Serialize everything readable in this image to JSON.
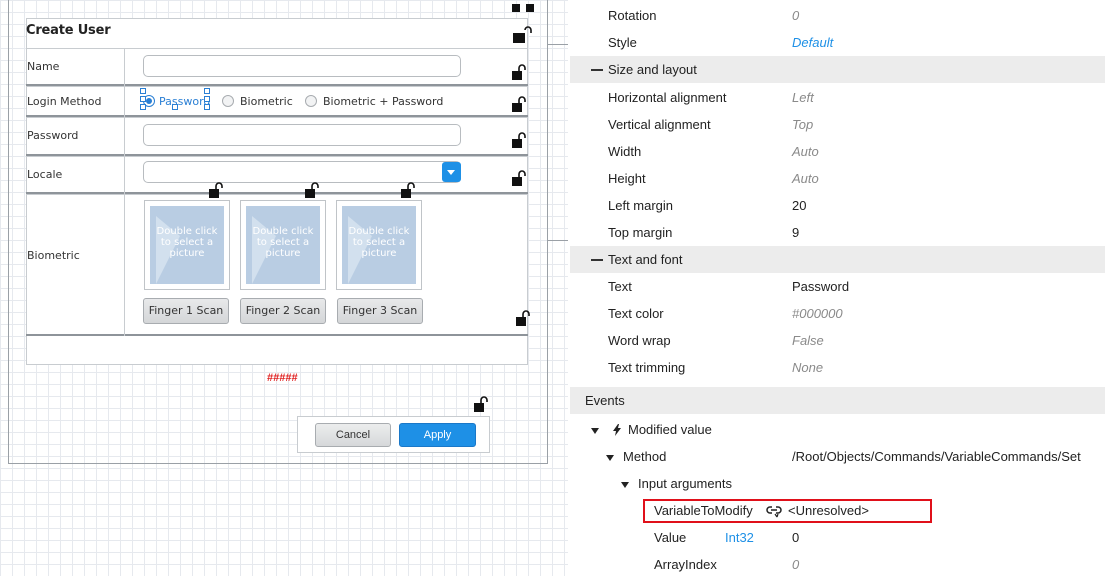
{
  "form": {
    "title": "Create User",
    "name_label": "Name",
    "login_method_label": "Login Method",
    "password_label": "Password",
    "locale_label": "Locale",
    "biometric_label": "Biometric",
    "radio_options": [
      "Password",
      "Biometric",
      "Biometric + Password"
    ],
    "picture_placeholder": "Double click to select a picture",
    "scan_buttons": [
      "Finger 1 Scan",
      "Finger 2 Scan",
      "Finger 3 Scan"
    ],
    "error_text": "#####",
    "cancel_label": "Cancel",
    "apply_label": "Apply"
  },
  "properties": {
    "rotation_label": "Rotation",
    "rotation_value": "0",
    "style_label": "Style",
    "style_value": "Default",
    "size_layout_section": "Size and layout",
    "halign_label": "Horizontal alignment",
    "halign_value": "Left",
    "valign_label": "Vertical alignment",
    "valign_value": "Top",
    "width_label": "Width",
    "width_value": "Auto",
    "height_label": "Height",
    "height_value": "Auto",
    "left_margin_label": "Left margin",
    "left_margin_value": "20",
    "top_margin_label": "Top margin",
    "top_margin_value": "9",
    "text_font_section": "Text and font",
    "text_label": "Text",
    "text_value": "Password",
    "text_color_label": "Text color",
    "text_color_value": "#000000",
    "word_wrap_label": "Word wrap",
    "word_wrap_value": "False",
    "text_trimming_label": "Text trimming",
    "text_trimming_value": "None"
  },
  "events": {
    "section": "Events",
    "modified_value": "Modified value",
    "method_label": "Method",
    "method_value": "/Root/Objects/Commands/VariableCommands/Set",
    "input_arguments": "Input arguments",
    "variable_to_modify_label": "VariableToModify",
    "variable_to_modify_value": "<Unresolved>",
    "value_label": "Value",
    "value_type": "Int32",
    "value_value": "0",
    "array_index_label": "ArrayIndex",
    "array_index_value": "0"
  },
  "colors": {
    "accent": "#1e90e6",
    "error": "#e0101a",
    "section_bg": "#ececec"
  }
}
